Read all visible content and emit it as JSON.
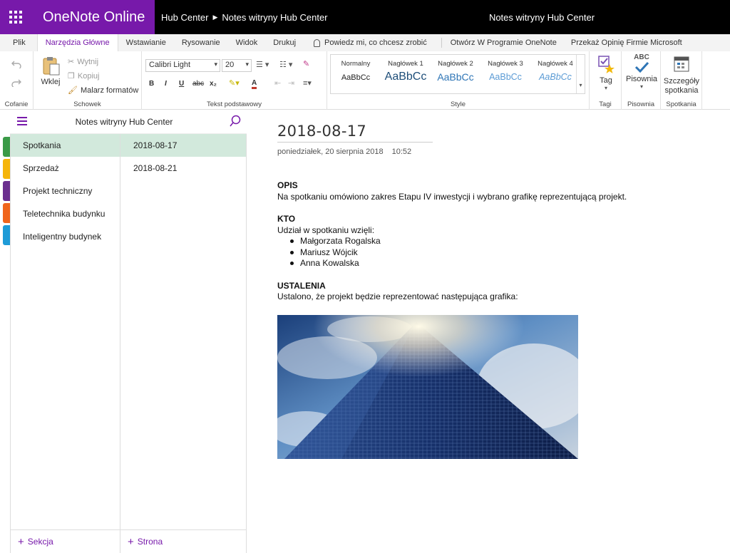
{
  "app": {
    "name": "OneNote Online",
    "breadcrumb": [
      "Hub Center",
      "Notes witryny Hub Center"
    ],
    "document_title": "Notes witryny Hub Center"
  },
  "tabs": [
    {
      "label": "Plik",
      "active": false
    },
    {
      "label": "Narzędzia Główne",
      "active": true
    },
    {
      "label": "Wstawianie",
      "active": false
    },
    {
      "label": "Rysowanie",
      "active": false
    },
    {
      "label": "Widok",
      "active": false
    },
    {
      "label": "Drukuj",
      "active": false
    }
  ],
  "tell_me": "Powiedz mi, co chcesz zrobić",
  "open_in_app": "Otwórz W Programie OneNote",
  "feedback": "Przekaż Opinię Firmie Microsoft",
  "ribbon": {
    "undo_group": "Cofanie",
    "clipboard": {
      "group": "Schowek",
      "paste": "Wklej",
      "cut": "Wytnij",
      "copy": "Kopiuj",
      "format_painter": "Malarz formatów"
    },
    "basic_text": {
      "group": "Tekst podstawowy",
      "font": "Calibri Light",
      "size": "20",
      "bold": "B",
      "italic": "I",
      "underline": "U",
      "strike": "abc",
      "subscript": "x₂",
      "font_color": "A"
    },
    "styles": {
      "group": "Style",
      "items": [
        {
          "name": "Normalny",
          "sample": "AaBbCc"
        },
        {
          "name": "Nagłówek 1",
          "sample": "AaBbCc"
        },
        {
          "name": "Nagłówek 2",
          "sample": "AaBbCc"
        },
        {
          "name": "Nagłówek 3",
          "sample": "AaBbCc"
        },
        {
          "name": "Nagłówek 4",
          "sample": "AaBbCc"
        }
      ]
    },
    "tags": {
      "group": "Tagi",
      "tag": "Tag"
    },
    "spelling": {
      "group": "Pisownia",
      "button": "Pisownia",
      "icon_text": "ABC"
    },
    "meetings": {
      "group": "Spotkania",
      "button_line1": "Szczegóły",
      "button_line2": "spotkania"
    }
  },
  "notebook": {
    "title": "Notes witryny Hub Center"
  },
  "sections": [
    {
      "label": "Spotkania",
      "color": "#3a9a47",
      "selected": true
    },
    {
      "label": "Sprzedaż",
      "color": "#f5b50a",
      "selected": false
    },
    {
      "label": "Projekt techniczny",
      "color": "#6b2f8f",
      "selected": false
    },
    {
      "label": "Teletechnika budynku",
      "color": "#f0651c",
      "selected": false
    },
    {
      "label": "Inteligentny budynek",
      "color": "#1e9bd7",
      "selected": false
    }
  ],
  "pages": [
    {
      "label": "2018-08-17",
      "selected": true
    },
    {
      "label": "2018-08-21",
      "selected": false
    }
  ],
  "add_section": "Sekcja",
  "add_page": "Strona",
  "page": {
    "title": "2018-08-17",
    "date": "poniedziałek, 20 sierpnia 2018",
    "time": "10:52",
    "opis_heading": "OPIS",
    "opis_text": "Na spotkaniu omówiono zakres Etapu IV inwestycji i wybrano grafikę reprezentującą projekt.",
    "kto_heading": "KTO",
    "kto_text": "Udział w spotkaniu wzięli:",
    "participants": [
      "Małgorzata Rogalska",
      "Mariusz Wójcik",
      "Anna Kowalska"
    ],
    "ustalenia_heading": "USTALENIA",
    "ustalenia_text": "Ustalono, że projekt będzie reprezentować następująca grafika:"
  },
  "colors": {
    "brand": "#7719aa",
    "selection": "#d2e9dc"
  }
}
